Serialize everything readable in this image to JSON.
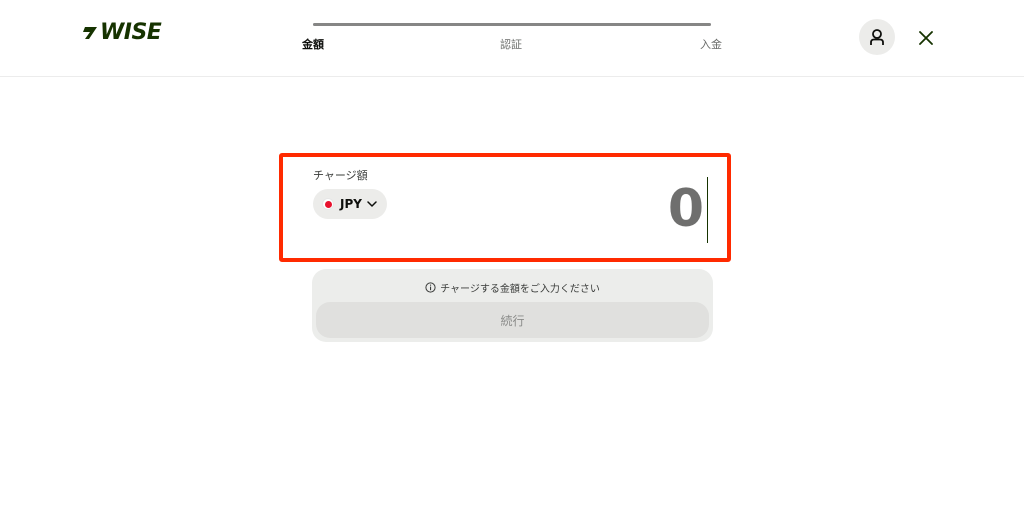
{
  "header": {
    "logo_text": "WISE",
    "steps": [
      {
        "label": "金額",
        "active": true
      },
      {
        "label": "認証",
        "active": false
      },
      {
        "label": "入金",
        "active": false
      }
    ],
    "progress": 1.0,
    "profile_icon": "user-icon",
    "close_icon": "close-icon"
  },
  "charge": {
    "label": "チャージ額",
    "currency_code": "JPY",
    "flag": "japan-flag-icon",
    "amount": "0"
  },
  "footer": {
    "hint": "チャージする金額をご入力ください",
    "hint_icon": "info-icon",
    "continue_label": "続行"
  },
  "colors": {
    "brand": "#163300",
    "highlight_border": "#ff2a00",
    "panel_bg": "#ecedeb"
  }
}
